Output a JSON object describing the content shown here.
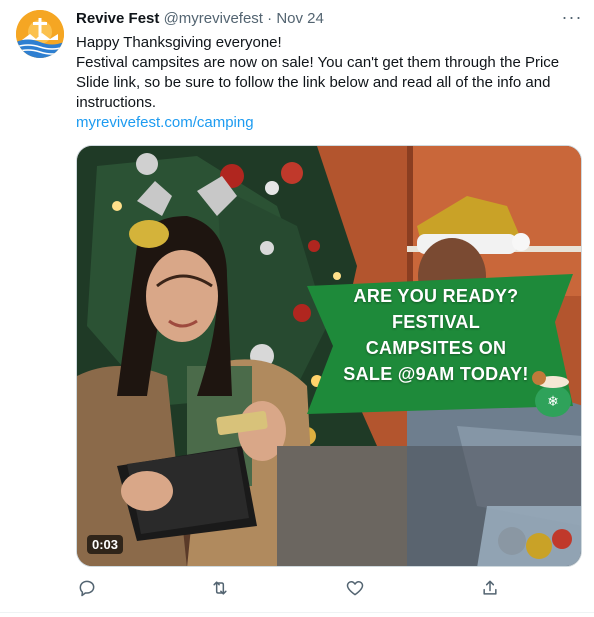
{
  "tweet": {
    "author_name": "Revive Fest",
    "author_handle": "@myrevivefest",
    "separator": "·",
    "date": "Nov 24",
    "more_label": "···",
    "text_line1": "Happy Thanksgiving everyone!",
    "text_line2": "Festival campsites are now on sale!  You can't get them through the Price Slide link, so be sure to follow the link below and read all of the info and instructions.",
    "link_text": "myrevivefest.com/camping"
  },
  "media": {
    "overlay_lines": [
      "ARE YOU READY?",
      "FESTIVAL",
      "CAMPSITES ON",
      "SALE @9AM TODAY!"
    ],
    "timestamp": "0:03"
  },
  "actions": [
    {
      "icon": "reply-icon"
    },
    {
      "icon": "retweet-icon"
    },
    {
      "icon": "like-icon"
    },
    {
      "icon": "share-icon"
    }
  ],
  "colors": {
    "link": "#1d9bf0",
    "secondary_text": "#536471",
    "banner_green": "#1e8a3a",
    "avatar_orange": "#f5a623"
  }
}
